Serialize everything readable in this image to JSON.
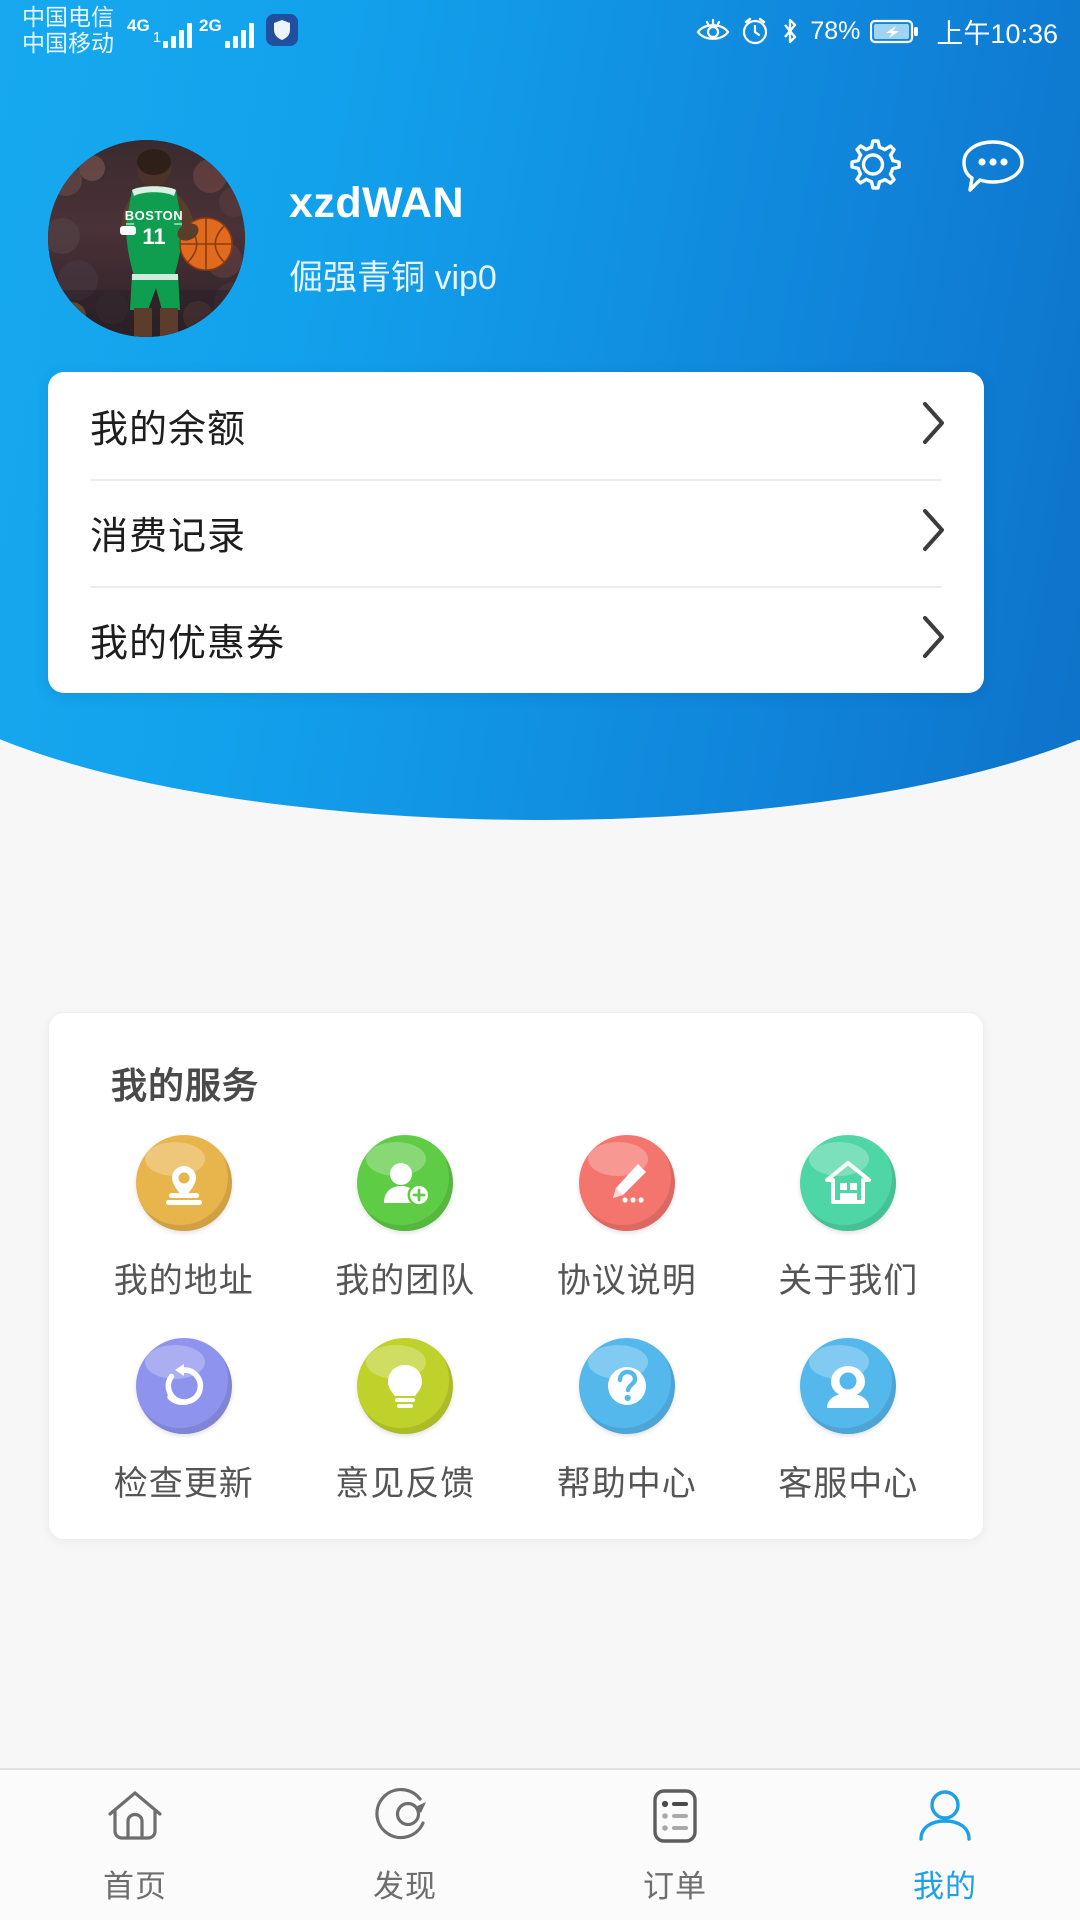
{
  "status_bar": {
    "carriers": [
      "中国电信",
      "中国移动"
    ],
    "sim1_network": "4G",
    "sim2_network": "2G",
    "sim1_prefix": "1",
    "shield_icon": "shield-icon",
    "eye_icon": "eye-icon",
    "alarm_icon": "alarm-clock-icon",
    "bluetooth_icon": "bluetooth-icon",
    "battery_percent": "78%",
    "battery_icon": "battery-charging-icon",
    "time": "上午10:36"
  },
  "header": {
    "avatar_name": "avatar",
    "username": "xzdWAN",
    "level_text": "倔强青铜  vip0",
    "settings_icon": "gear-icon",
    "message_icon": "chat-bubble-icon",
    "gradient_start": "#19ABF0",
    "gradient_end": "#0B6CC2"
  },
  "account_menu": {
    "items": [
      {
        "label": "我的余额",
        "name": "menu-item-balance",
        "chevron": "chevron-right-icon"
      },
      {
        "label": "消费记录",
        "name": "menu-item-consumption",
        "chevron": "chevron-right-icon"
      },
      {
        "label": "我的优惠券",
        "name": "menu-item-coupons",
        "chevron": "chevron-right-icon"
      }
    ]
  },
  "services": {
    "title": "我的服务",
    "items": [
      {
        "label": "我的地址",
        "icon": "location-pin-icon",
        "color": "#E8B44C"
      },
      {
        "label": "我的团队",
        "icon": "add-person-icon",
        "color": "#5FCC46"
      },
      {
        "label": "协议说明",
        "icon": "pencil-edit-icon",
        "color": "#F4756E"
      },
      {
        "label": "关于我们",
        "icon": "home-building-icon",
        "color": "#4FD6A7"
      },
      {
        "label": "检查更新",
        "icon": "refresh-circle-icon",
        "color": "#8E93EE"
      },
      {
        "label": "意见反馈",
        "icon": "lightbulb-icon",
        "color": "#BFD22C"
      },
      {
        "label": "帮助中心",
        "icon": "question-mark-icon",
        "color": "#55B8EC"
      },
      {
        "label": "客服中心",
        "icon": "customer-service-icon",
        "color": "#55B8EC"
      }
    ]
  },
  "tabbar": {
    "active_color": "#1DA0E8",
    "inactive_color": "#6E6E6E",
    "items": [
      {
        "label": "首页",
        "icon": "home-icon",
        "name": "tab-home",
        "active": false
      },
      {
        "label": "发现",
        "icon": "compass-icon",
        "name": "tab-discover",
        "active": false
      },
      {
        "label": "订单",
        "icon": "list-icon",
        "name": "tab-orders",
        "active": false
      },
      {
        "label": "我的",
        "icon": "person-icon",
        "name": "tab-mine",
        "active": true
      }
    ]
  }
}
